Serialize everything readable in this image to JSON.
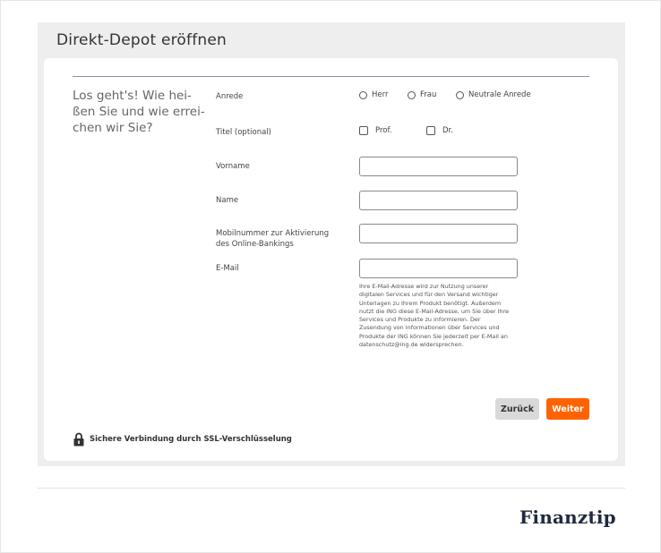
{
  "panel": {
    "title": "Direkt-Depot eröffnen"
  },
  "form": {
    "intro_lines": [
      "Los geht's! Wie hei-",
      "ßen Sie und wie errei-",
      "chen wir Sie?"
    ],
    "salutation": {
      "label": "Anrede",
      "options": [
        "Herr",
        "Frau",
        "Neutrale Anrede"
      ]
    },
    "title": {
      "label": "Titel (optional)",
      "options": [
        "Prof.",
        "Dr."
      ]
    },
    "first_name": {
      "label": "Vorname",
      "value": ""
    },
    "last_name": {
      "label": "Name",
      "value": ""
    },
    "mobile": {
      "label_lines": [
        "Mobilnummer zur Aktivierung",
        "des Online-Bankings"
      ],
      "value": ""
    },
    "email": {
      "label": "E-Mail",
      "value": "",
      "hint_lines": [
        "Ihre E-Mail-Adresse wird zur Nutzung unserer",
        "digitalen Services und für den Versand wichtiger",
        "Unterlagen zu Ihrem Produkt benötigt. Außerdem",
        "nutzt die ING diese E-Mail-Adresse, um Sie über Ihre",
        "Services und Produkte zu informieren. Der",
        "Zusendung von Informationen über Services und",
        "Produkte der ING können Sie jederzeit per E-Mail an",
        "datenschutz@ing.de widersprechen."
      ]
    }
  },
  "buttons": {
    "back": "Zurück",
    "next": "Weiter"
  },
  "security": {
    "text": "Sichere Verbindung durch SSL-Verschlüsselung",
    "icon": "lock-icon"
  },
  "brand": {
    "name": "Finanztip"
  },
  "colors": {
    "accent": "#ff6200",
    "panel_bg": "#eeeeee",
    "brand_text": "#1e2a3d"
  }
}
